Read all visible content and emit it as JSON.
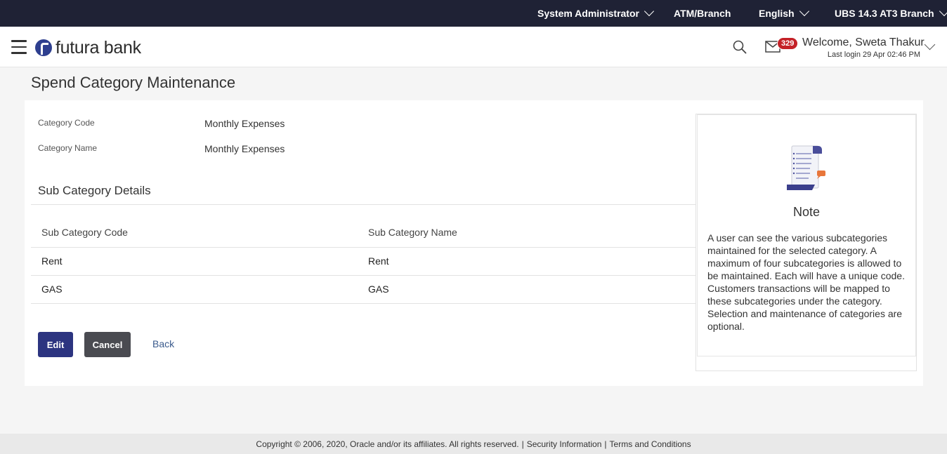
{
  "topbar": {
    "role": "System Administrator",
    "location": "ATM/Branch",
    "language": "English",
    "branch": "UBS 14.3 AT3 Branch"
  },
  "header": {
    "brand": "futura bank",
    "notification_count": "329",
    "welcome": "Welcome, Sweta Thakur",
    "last_login": "Last login 29 Apr 02:46 PM",
    "icons": [
      "menu-icon",
      "logo-icon",
      "search-icon",
      "mail-icon",
      "chevron-down-icon"
    ]
  },
  "page": {
    "title": "Spend Category Maintenance"
  },
  "details": {
    "category_code_label": "Category Code",
    "category_code_value": "Monthly Expenses",
    "category_name_label": "Category Name",
    "category_name_value": "Monthly Expenses"
  },
  "subcategory": {
    "section_title": "Sub Category Details",
    "columns": [
      "Sub Category Code",
      "Sub Category Name"
    ],
    "rows": [
      {
        "code": "Rent",
        "name": "Rent"
      },
      {
        "code": "GAS",
        "name": "GAS"
      }
    ]
  },
  "actions": {
    "edit": "Edit",
    "cancel": "Cancel",
    "back": "Back"
  },
  "note": {
    "title": "Note",
    "text": "A user can see the various subcategories maintained for the selected category. A maximum of four subcategories is allowed to be maintained. Each will have a unique code.\nCustomers transactions will be mapped to these subcategories under the category.\nSelection and maintenance of categories are optional."
  },
  "footer": {
    "copyright": "Copyright © 2006, 2020, Oracle and/or its affiliates. All rights reserved.",
    "separator": "|",
    "security": "Security Information",
    "terms": "Terms and Conditions"
  },
  "colors": {
    "topbar": "#1f2235",
    "primary_button": "#2c3480",
    "secondary_button": "#4a4b51",
    "badge": "#c42127",
    "link": "#3b5b8d"
  }
}
